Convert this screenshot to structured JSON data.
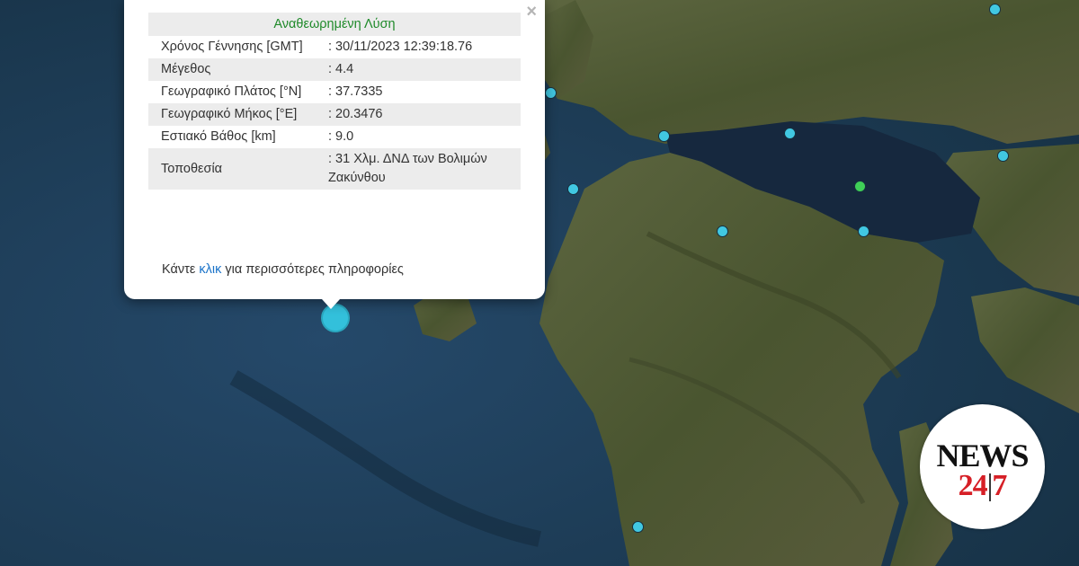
{
  "popup": {
    "title": "Αναθεωρημένη Λύση",
    "close_symbol": "×",
    "rows": [
      {
        "label": "Χρόνος Γέννησης [GMT]",
        "value": ": 30/11/2023 12:39:18.76"
      },
      {
        "label": "Μέγεθος",
        "value": ": 4.4"
      },
      {
        "label": "Γεωγραφικό Πλάτος [°N]",
        "value": ": 37.7335"
      },
      {
        "label": "Γεωγραφικό Μήκος [°E]",
        "value": ": 20.3476"
      },
      {
        "label": "Εστιακό Βάθος [km]",
        "value": ": 9.0"
      },
      {
        "label": "Τοποθεσία",
        "value": ": 31 Χλμ. ΔΝΔ των Βολιμών Ζακύνθου"
      }
    ],
    "footer_before": "Κάντε ",
    "footer_link": "κλικ",
    "footer_after": " για περισσότερες πληροφορίες"
  },
  "logo": {
    "top": "NEWS",
    "bottom_left": "24",
    "divider": "|",
    "bottom_right": "7"
  },
  "colors": {
    "sea": "#1d3b52",
    "land": "#4f5a35",
    "marker": "#41c8e2",
    "marker_recent": "#3fcf57",
    "popup_title": "#1f8a2a",
    "link": "#1a73c9",
    "logo_accent": "#d61f26"
  }
}
